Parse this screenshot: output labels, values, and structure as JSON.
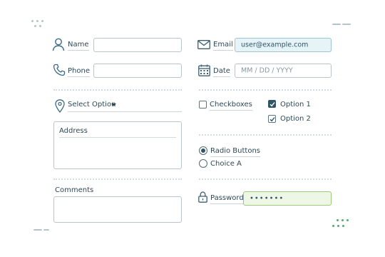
{
  "form": {
    "name": {
      "label": "Name",
      "value": ""
    },
    "phone": {
      "label": "Phone",
      "value": ""
    },
    "email": {
      "label": "Email",
      "value": "user@example.com"
    },
    "date": {
      "label": "Date",
      "placeholder": "MM / DD / YYYY"
    },
    "select": {
      "label": "Select Option"
    },
    "address": {
      "label": "Address"
    },
    "comments": {
      "label": "Comments"
    },
    "checkboxes": {
      "label": "Checkboxes",
      "options": [
        {
          "label": "Option 1",
          "checked": true
        },
        {
          "label": "Option 2",
          "checked": true
        }
      ]
    },
    "radios": {
      "options": [
        {
          "label": "Radio Buttons",
          "selected": true
        },
        {
          "label": "Choice A",
          "selected": false
        }
      ]
    },
    "password": {
      "label": "Password",
      "value": "•••••••"
    }
  },
  "colors": {
    "accent_blue_bg": "#e6f4f8",
    "accent_green_bg": "#eef7e6",
    "accent_green_border": "#9cc97a",
    "dark_teal": "#2f5566"
  },
  "icons": [
    "user-icon",
    "phone-icon",
    "email-icon",
    "calendar-icon",
    "location-pin-icon",
    "lock-icon",
    "caret-down-icon",
    "check-icon"
  ]
}
